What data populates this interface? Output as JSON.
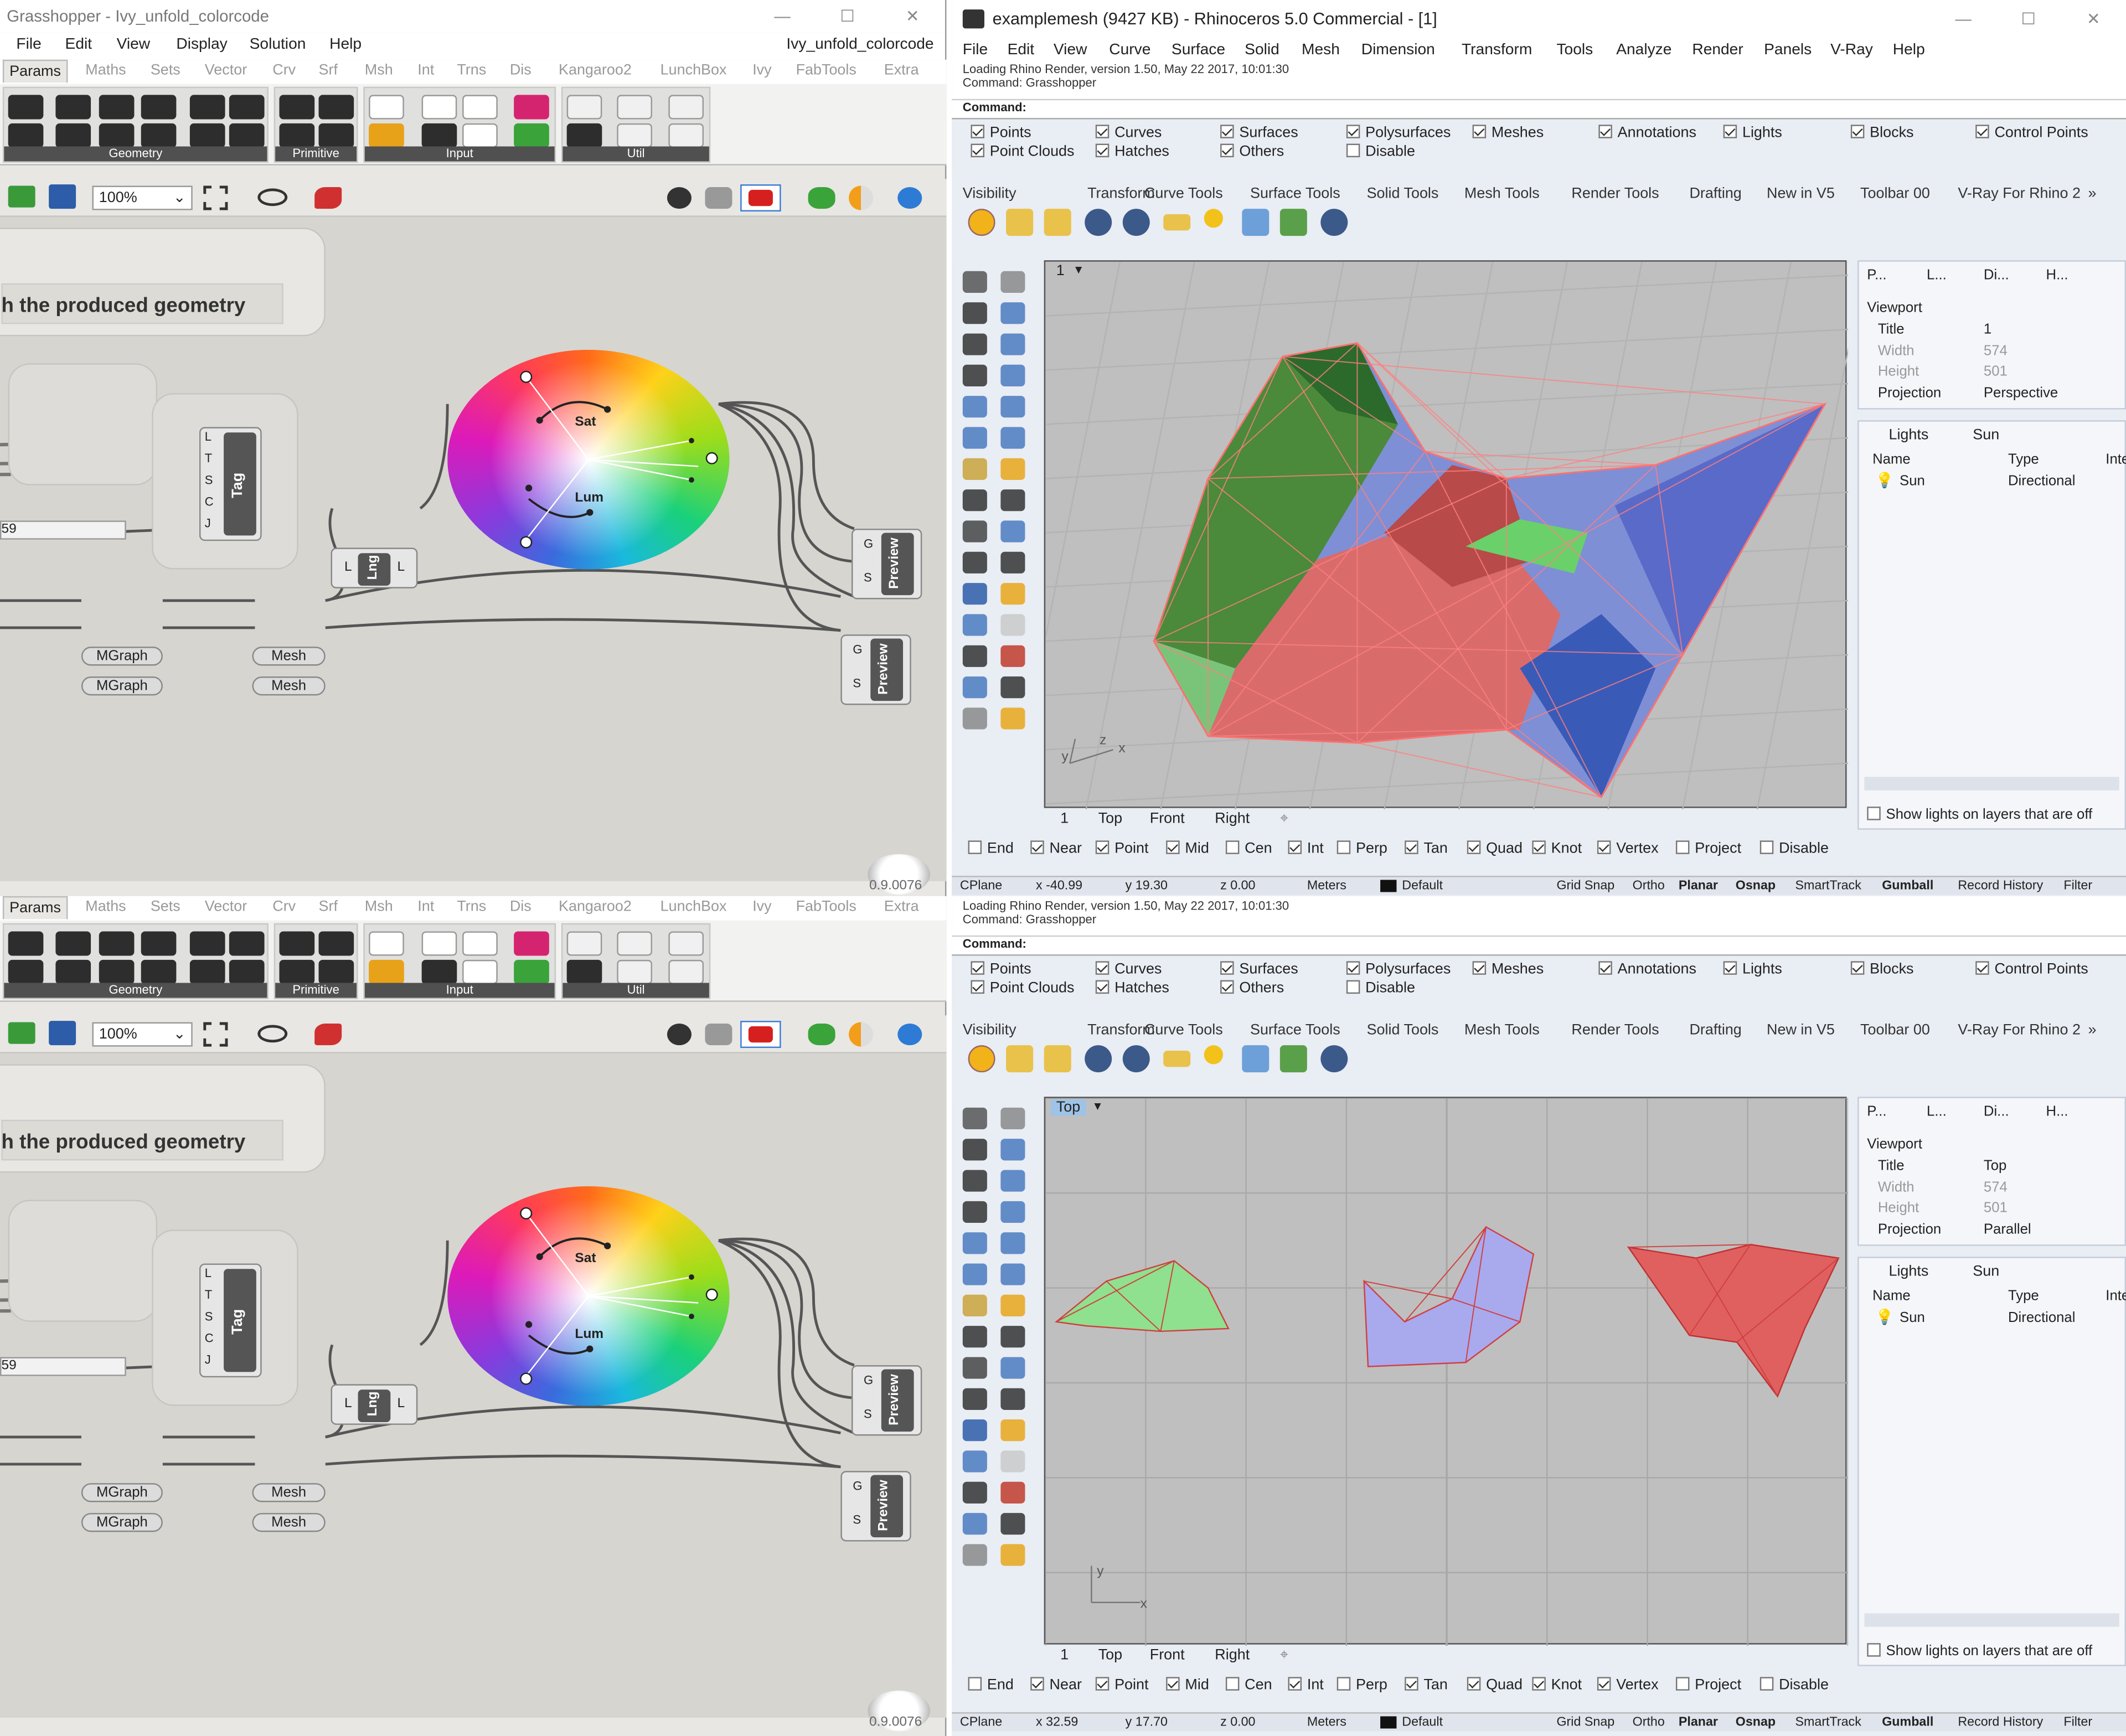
{
  "grasshopper": {
    "title": "Grasshopper - Ivy_unfold_colorcode",
    "doc_name": "Ivy_unfold_colorcode",
    "menu": [
      "File",
      "Edit",
      "View",
      "Display",
      "Solution",
      "Help"
    ],
    "tabs": [
      "Params",
      "Maths",
      "Sets",
      "Vector",
      "Crv",
      "Srf",
      "Msh",
      "Int",
      "Trns",
      "Dis",
      "Kangaroo2",
      "LunchBox",
      "Ivy",
      "FabTools",
      "Extra"
    ],
    "groups": [
      "Geometry",
      "Primitive",
      "Input",
      "Util"
    ],
    "zoom": "100%",
    "canvas_text": "h the produced geometry",
    "slider_value": "59",
    "tag_inputs": [
      "L",
      "T",
      "S",
      "C",
      "J"
    ],
    "tag_label": "Tag",
    "lng_label": "Lng",
    "lng_in": "L",
    "lng_out": "L",
    "sat_label": "Sat",
    "lum_label": "Lum",
    "preview_label": "Preview",
    "preview_inputs": [
      "G",
      "S"
    ],
    "mgraph": "MGraph",
    "mesh": "Mesh",
    "version": "0.9.0076"
  },
  "rhino": {
    "title": "examplemesh (9427 KB) - Rhinoceros 5.0 Commercial - [1]",
    "menu": [
      "File",
      "Edit",
      "View",
      "Curve",
      "Surface",
      "Solid",
      "Mesh",
      "Dimension",
      "Transform",
      "Tools",
      "Analyze",
      "Render",
      "Panels",
      "V-Ray",
      "Help"
    ],
    "history": [
      "Loading Rhino Render, version 1.50, May 22 2017, 10:01:30",
      "Command: Grasshopper"
    ],
    "command_label": "Command:",
    "filters_row1": [
      "Points",
      "Curves",
      "Surfaces",
      "Polysurfaces",
      "Meshes",
      "Annotations",
      "Lights",
      "Blocks",
      "Control Points"
    ],
    "filters_row2": [
      "Point Clouds",
      "Hatches",
      "Others",
      "Disable"
    ],
    "toolbar_tabs": [
      "Visibility",
      "Transform",
      "Curve Tools",
      "Surface Tools",
      "Solid Tools",
      "Mesh Tools",
      "Render Tools",
      "Drafting",
      "New in V5",
      "Toolbar 00",
      "V-Ray For Rhino 2"
    ],
    "top_viewport_label": "1",
    "bottom_viewport_label": "Top",
    "viewport_tabs": [
      "1",
      "Top",
      "Front",
      "Right"
    ],
    "osnaps": [
      "End",
      "Near",
      "Point",
      "Mid",
      "Cen",
      "Int",
      "Perp",
      "Tan",
      "Quad",
      "Knot",
      "Vertex",
      "Project",
      "Disable"
    ],
    "osnap_checked": [
      false,
      true,
      true,
      true,
      false,
      true,
      false,
      true,
      true,
      true,
      true,
      false,
      false
    ],
    "panel_tabs": [
      "P...",
      "L...",
      "Di...",
      "H..."
    ],
    "viewport_panel": {
      "heading": "Viewport",
      "title_label": "Title",
      "width_label": "Width",
      "height_label": "Height",
      "projection_label": "Projection",
      "width": "574",
      "height": "501"
    },
    "top_panel": {
      "title": "1",
      "projection": "Perspective"
    },
    "bottom_panel": {
      "title": "Top",
      "projection": "Parallel"
    },
    "lights_tabs": [
      "Lights",
      "Sun"
    ],
    "lights_columns": [
      "Name",
      "Type",
      "Inte"
    ],
    "light_row": {
      "name": "Sun",
      "type": "Directional"
    },
    "show_lights": "Show lights on layers that are off",
    "status_top": {
      "cplane": "CPlane",
      "x": "x -40.99",
      "y": "y 19.30",
      "z": "z 0.00",
      "units": "Meters",
      "layer": "Default"
    },
    "status_bottom": {
      "cplane": "CPlane",
      "x": "x 32.59",
      "y": "y 17.70",
      "z": "z 0.00",
      "units": "Meters",
      "layer": "Default"
    },
    "status_buttons": [
      "Grid Snap",
      "Ortho",
      "Planar",
      "Osnap",
      "SmartTrack",
      "Gumball",
      "Record History",
      "Filter"
    ],
    "axis": {
      "x": "x",
      "y": "y",
      "z": "z"
    }
  }
}
